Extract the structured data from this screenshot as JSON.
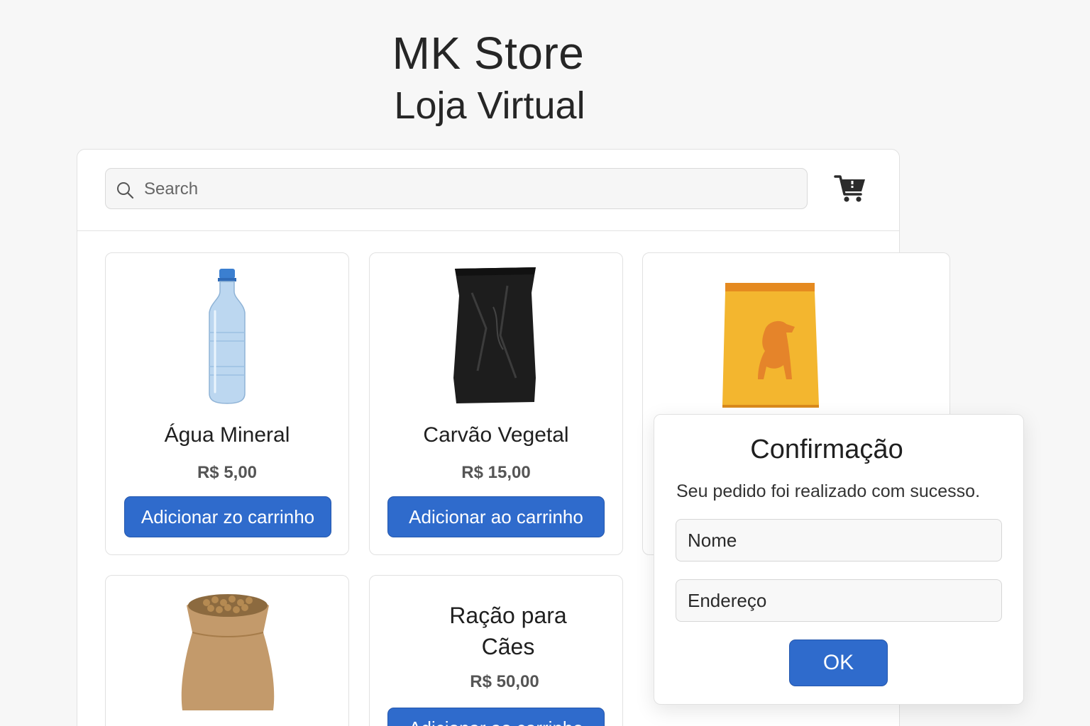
{
  "store": {
    "title": "MK Store",
    "subtitle": "Loja Virtual"
  },
  "header": {
    "search_placeholder": "Search",
    "search_icon": "search-icon",
    "cart_icon": "cart-icon"
  },
  "products": [
    {
      "name": "Água Mineral",
      "price": "R$ 5,00",
      "button": "Adicionar zo carrinho",
      "icon": "water-bottle"
    },
    {
      "name": "Carvão Vegetal",
      "price": "R$ 15,00",
      "button": "Adicionar ao carrinho",
      "icon": "charcoal-bag"
    },
    {
      "name": "",
      "price": "",
      "button": "",
      "icon": "dog-food-bag"
    },
    {
      "name": "",
      "price": "",
      "button": "",
      "icon": "grain-sack"
    },
    {
      "name": "Ração para Cães",
      "price": "R$ 50,00",
      "button": "Adicionar ao carrinho",
      "icon": ""
    }
  ],
  "modal": {
    "title": "Confirmação",
    "message": "Seu pedido foi realizado com sucesso.",
    "name_placeholder": "Nome",
    "address_placeholder": "Endereço",
    "ok_label": "OK"
  },
  "colors": {
    "primary_button": "#2f6bcc",
    "background": "#f7f7f7",
    "card": "#ffffff",
    "text": "#222222"
  }
}
